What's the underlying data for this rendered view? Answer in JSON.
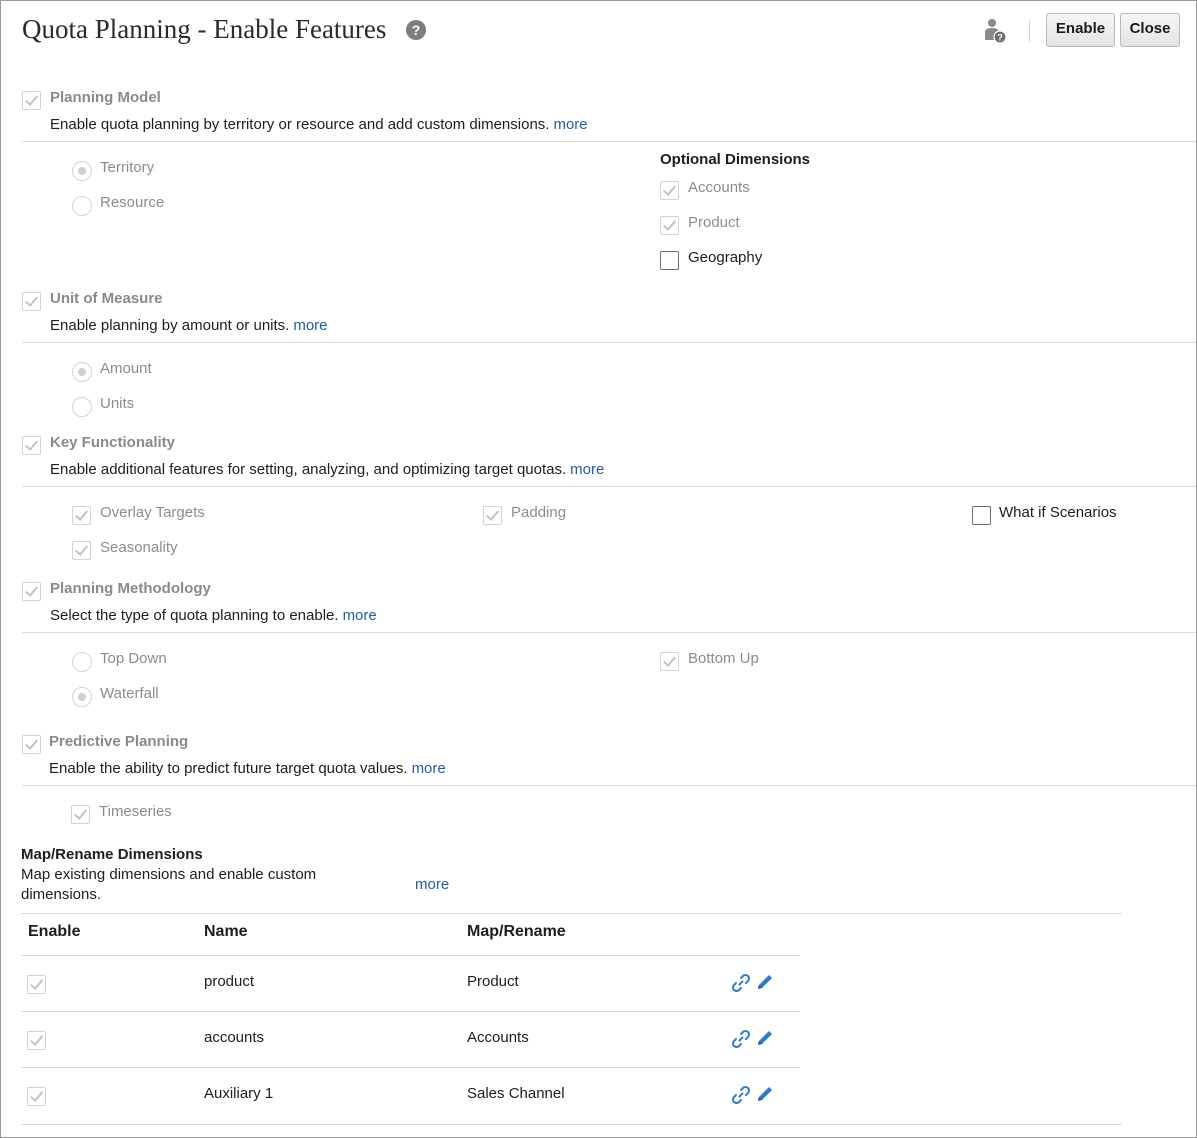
{
  "header": {
    "title": "Quota Planning - Enable Features",
    "help_glyph": "?",
    "enable_label": "Enable",
    "close_label": "Close"
  },
  "planning_model": {
    "title": "Planning Model",
    "description": "Enable quota planning by territory or resource and add custom dimensions.",
    "more": "more",
    "options": [
      "Territory",
      "Resource"
    ],
    "selected": "Territory",
    "optional_dimensions_heading": "Optional Dimensions",
    "optional_dimensions": [
      {
        "label": "Accounts",
        "checked": true
      },
      {
        "label": "Product",
        "checked": true
      },
      {
        "label": "Geography",
        "checked": false
      }
    ]
  },
  "unit_of_measure": {
    "title": "Unit of Measure",
    "description": "Enable planning by amount or units.",
    "more": "more",
    "options": [
      "Amount",
      "Units"
    ],
    "selected": "Amount"
  },
  "key_functionality": {
    "title": "Key Functionality",
    "description": "Enable additional features for setting, analyzing, and optimizing target quotas.",
    "more": "more",
    "features": [
      {
        "label": "Overlay Targets",
        "checked": true
      },
      {
        "label": "Padding",
        "checked": true
      },
      {
        "label": "What if Scenarios",
        "checked": false
      },
      {
        "label": "Seasonality",
        "checked": true
      }
    ]
  },
  "planning_methodology": {
    "title": "Planning Methodology",
    "description": "Select the type of quota planning to enable.",
    "more": "more",
    "options": [
      "Top Down",
      "Waterfall"
    ],
    "selected": "Waterfall",
    "bottom_up": {
      "label": "Bottom Up",
      "checked": true
    }
  },
  "predictive_planning": {
    "title": "Predictive Planning",
    "description": "Enable the ability to predict future target quota values.",
    "more": "more",
    "timeseries": {
      "label": "Timeseries",
      "checked": true
    }
  },
  "map_rename": {
    "title": "Map/Rename Dimensions",
    "description_line1": "Map existing dimensions and enable custom",
    "description_line2": "dimensions.",
    "more": "more",
    "columns": [
      "Enable",
      "Name",
      "Map/Rename"
    ],
    "rows": [
      {
        "enabled": true,
        "name": "product",
        "map": "Product"
      },
      {
        "enabled": true,
        "name": "accounts",
        "map": "Accounts"
      },
      {
        "enabled": true,
        "name": "Auxiliary 1",
        "map": "Sales Channel"
      }
    ]
  },
  "colors": {
    "link": "#1f5ea8",
    "icon_blue": "#2a7bd3",
    "disabled_text": "#8c8c8c"
  }
}
